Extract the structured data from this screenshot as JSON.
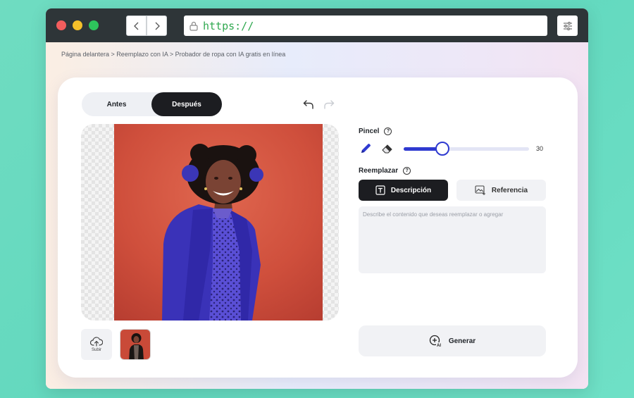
{
  "browser": {
    "url": "https://",
    "icons": [
      "chevron-left-icon",
      "chevron-right-icon",
      "lock-icon",
      "sliders-icon"
    ]
  },
  "breadcrumb": "Página delantera > Reemplazo con IA > Probador de ropa con IA gratis en línea",
  "toggle": {
    "before_label": "Antes",
    "after_label": "Después",
    "active": "Después"
  },
  "upload": {
    "label": "Subir"
  },
  "brush": {
    "label": "Pincel",
    "help": "?",
    "size_value": "30",
    "slider_fraction": 0.31,
    "accent_color": "#2f3ad0"
  },
  "replace": {
    "label": "Reemplazar",
    "help": "?",
    "tab_description": "Descripción",
    "tab_reference": "Referencia",
    "placeholder": "Describe el contenido que deseas reemplazar o agregar"
  },
  "generate": {
    "label": "Generar"
  }
}
